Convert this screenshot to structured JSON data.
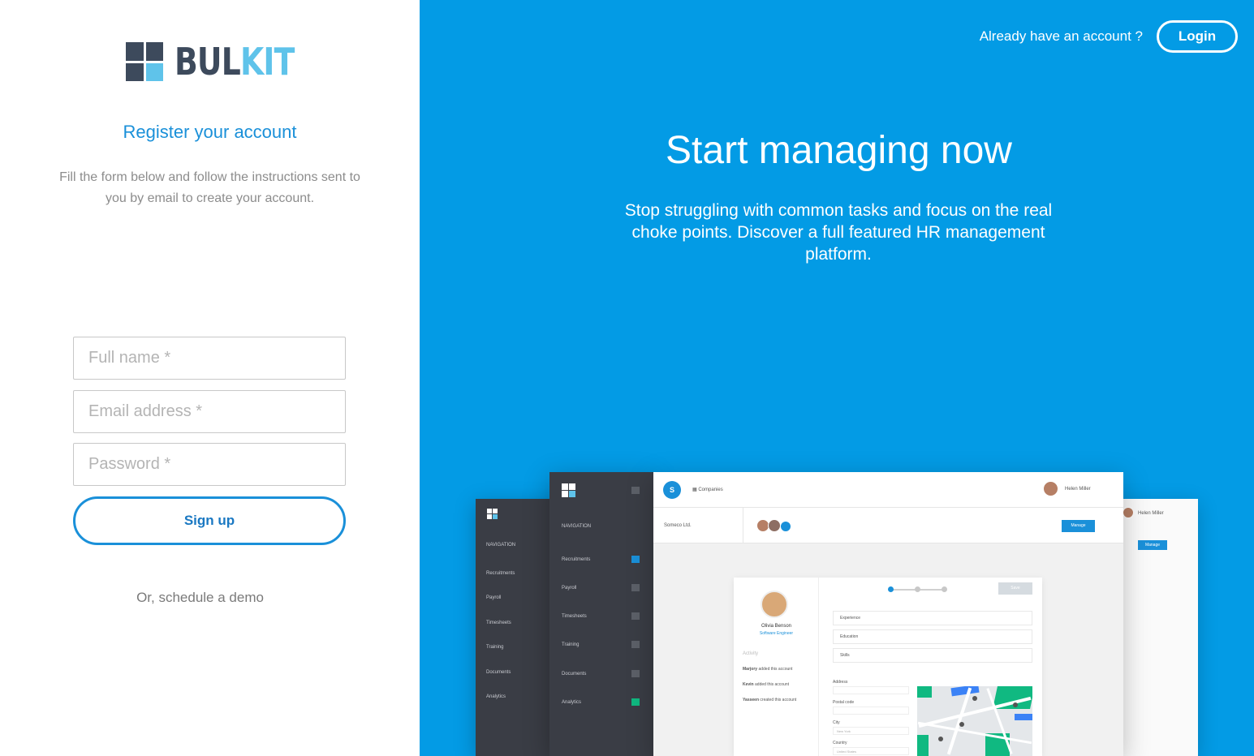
{
  "brand": {
    "logo_part_dark": "BUL",
    "logo_part_light": "KIT",
    "colors": {
      "dark": "#3d4a5c",
      "light": "#5fc3ea",
      "accent": "#1a90d9",
      "hero_bg": "#039be5"
    }
  },
  "register": {
    "title": "Register your account",
    "subtitle": "Fill the form below and follow the instructions sent to you by email to create your account.",
    "full_name_placeholder": "Full name *",
    "email_placeholder": "Email address *",
    "password_placeholder": "Password *",
    "signup_label": "Sign up",
    "demo_label": "Or, schedule a demo"
  },
  "header": {
    "already_text": "Already have an account ?",
    "login_label": "Login"
  },
  "hero": {
    "title": "Start managing now",
    "subtitle": "Stop struggling with common tasks and focus on the real choke points. Discover a full featured HR management platform."
  },
  "mockup": {
    "nav_heading": "NAVIGATION",
    "nav_items": [
      "Recruitments",
      "Payroll",
      "Timesheets",
      "Training",
      "Documents",
      "Analytics"
    ],
    "back_nav_items": [
      "Recruitments",
      "Payroll",
      "Timesheets",
      "Training",
      "Documents",
      "Analytics"
    ],
    "breadcrumb": "Companies",
    "company_badge": "S",
    "user_name": "Helen Miller",
    "company_name": "Someco Ltd.",
    "manage_label": "Manage",
    "profile_name": "Olivia Benson",
    "profile_role": "Software Engineer",
    "activity_label": "Activity",
    "activity": [
      {
        "who": "Marjory",
        "text": "added this account"
      },
      {
        "who": "Kevin",
        "text": "added this account"
      },
      {
        "who": "Yasseen",
        "text": "created this account"
      }
    ],
    "sections": [
      "Experience",
      "Education",
      "Skills"
    ],
    "form_labels": [
      "Address",
      "Postal code",
      "City",
      "Country"
    ],
    "city_value": "New York",
    "country_value": "United States",
    "save_label": "Save"
  }
}
